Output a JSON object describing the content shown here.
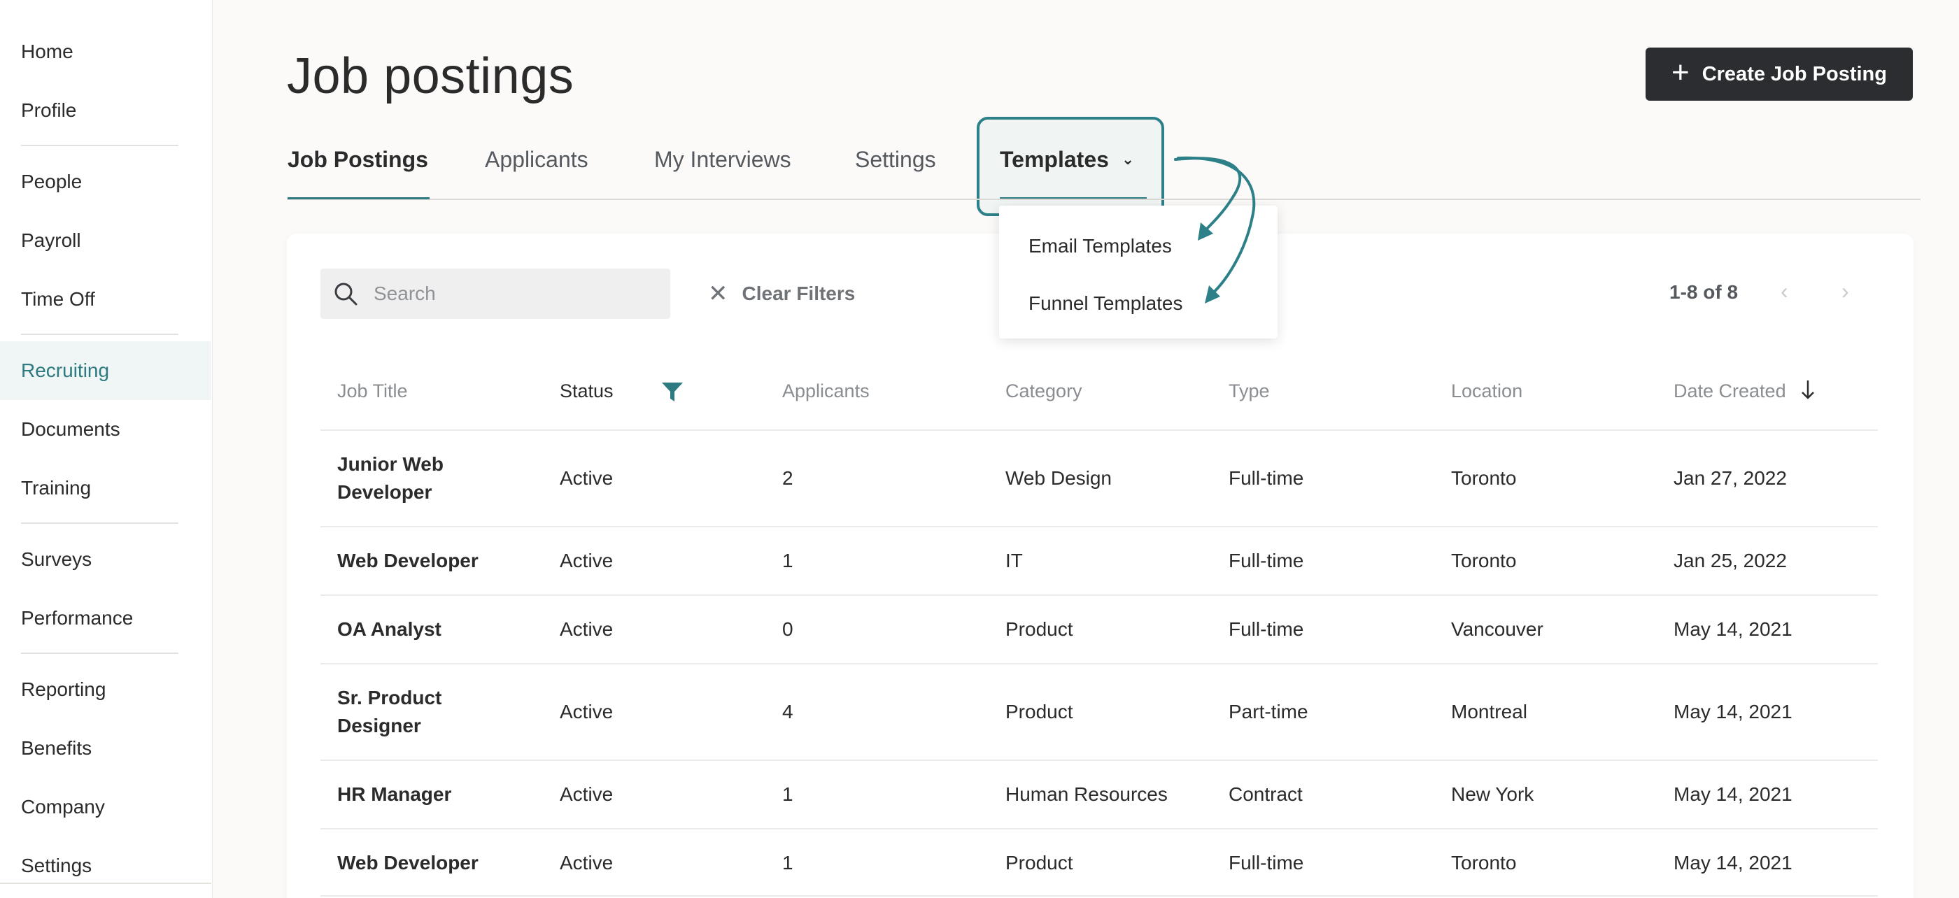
{
  "sidebar": {
    "items": [
      {
        "label": "Home"
      },
      {
        "label": "Profile"
      },
      {
        "label": "People"
      },
      {
        "label": "Payroll"
      },
      {
        "label": "Time Off"
      },
      {
        "label": "Recruiting"
      },
      {
        "label": "Documents"
      },
      {
        "label": "Training"
      },
      {
        "label": "Surveys"
      },
      {
        "label": "Performance"
      },
      {
        "label": "Reporting"
      },
      {
        "label": "Benefits"
      },
      {
        "label": "Company"
      },
      {
        "label": "Settings"
      }
    ],
    "active": "Recruiting"
  },
  "header": {
    "title": "Job postings",
    "create_button": "Create Job Posting"
  },
  "tabs": [
    {
      "label": "Job Postings",
      "active": true
    },
    {
      "label": "Applicants"
    },
    {
      "label": "My Interviews"
    },
    {
      "label": "Settings"
    },
    {
      "label": "Templates",
      "highlighted": true
    }
  ],
  "templates_menu": {
    "items": [
      "Email Templates",
      "Funnel Templates"
    ]
  },
  "toolbar": {
    "search_placeholder": "Search",
    "clear_filters": "Clear Filters",
    "pagination": "1-8 of 8"
  },
  "table": {
    "headers": [
      "Job Title",
      "Status",
      "Applicants",
      "Category",
      "Type",
      "Location",
      "Date Created"
    ],
    "rows": [
      [
        "Junior Web Developer",
        "Active",
        "2",
        "Web Design",
        "Full-time",
        "Toronto",
        "Jan 27, 2022"
      ],
      [
        "Web Developer",
        "Active",
        "1",
        "IT",
        "Full-time",
        "Toronto",
        "Jan 25, 2022"
      ],
      [
        "OA Analyst",
        "Active",
        "0",
        "Product",
        "Full-time",
        "Vancouver",
        "May 14, 2021"
      ],
      [
        "Sr. Product Designer",
        "Active",
        "4",
        "Product",
        "Part-time",
        "Montreal",
        "May 14, 2021"
      ],
      [
        "HR Manager",
        "Active",
        "1",
        "Human Resources",
        "Contract",
        "New York",
        "May 14, 2021"
      ],
      [
        "Web Developer",
        "Active",
        "1",
        "Product",
        "Full-time",
        "Toronto",
        "May 14, 2021"
      ]
    ]
  },
  "colors": {
    "accent": "#2d7a80",
    "button_bg": "#2b2d31",
    "page_bg": "#fbfaf9"
  }
}
